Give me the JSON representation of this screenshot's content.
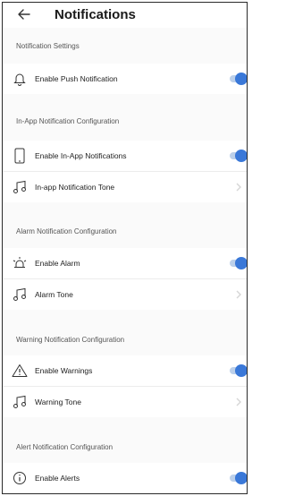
{
  "header": {
    "title": "Notifications",
    "back_icon": "arrow-left-icon"
  },
  "sections": [
    {
      "label": "Notification Settings"
    },
    {
      "label": "In-App Notification Configuration"
    },
    {
      "label": "Alarm Notification Configuration"
    },
    {
      "label": "Warning Notification Configuration"
    },
    {
      "label": "Alert Notification Configuration"
    }
  ],
  "rows": {
    "push": {
      "label": "Enable Push Notification",
      "icon": "bell-icon",
      "enabled": true
    },
    "inapp": {
      "label": "Enable In-App Notifications",
      "icon": "phone-icon",
      "enabled": true
    },
    "inapp_tone": {
      "label": "In-app Notification Tone",
      "icon": "music-note-icon"
    },
    "alarm": {
      "label": "Enable Alarm",
      "icon": "alarm-light-icon",
      "enabled": true
    },
    "alarm_tone": {
      "label": "Alarm Tone",
      "icon": "music-note-icon"
    },
    "warnings": {
      "label": "Enable Warnings",
      "icon": "warning-triangle-icon",
      "enabled": true
    },
    "warning_tone": {
      "label": "Warning Tone",
      "icon": "music-note-icon"
    },
    "alerts": {
      "label": "Enable Alerts",
      "icon": "info-circle-icon",
      "enabled": true
    }
  },
  "colors": {
    "accent": "#3a78d8",
    "track": "#bcd0ea",
    "background": "#fafafa"
  }
}
